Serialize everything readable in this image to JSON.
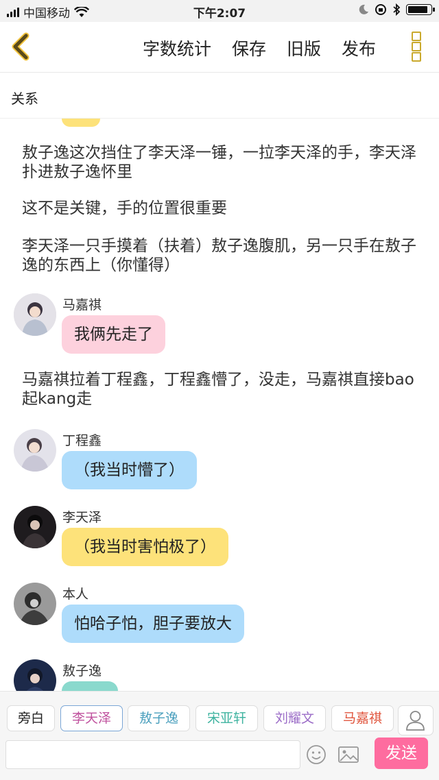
{
  "status_bar": {
    "carrier": "中国移动",
    "time": "下午2:07",
    "battery_fraction": 0.9
  },
  "nav": {
    "actions": [
      "字数统计",
      "保存",
      "旧版",
      "发布"
    ],
    "accent": "#c9a92c"
  },
  "relation_label": "关系",
  "narrations": [
    "敖子逸这次挡住了李天泽一锤，一拉李天泽的手，李天泽扑进敖子逸怀里",
    "这不是关键，手的位置很重要",
    "李天泽一只手摸着（扶着）敖子逸腹肌，另一只手在敖子逸的东西上（你懂得）",
    "马嘉祺拉着丁程鑫，丁程鑫懵了，没走，马嘉祺直接bao起kang走"
  ],
  "messages": [
    {
      "name": "马嘉祺",
      "text": "我俩先走了",
      "bubble_color": "#fdd1dd"
    },
    {
      "name": "丁程鑫",
      "text": "（我当时懵了）",
      "bubble_color": "#aedcfb"
    },
    {
      "name": "李天泽",
      "text": "（我当时害怕极了）",
      "bubble_color": "#fde27a"
    },
    {
      "name": "本人",
      "text": "怕哈子怕，胆子要放大",
      "bubble_color": "#aedcfb"
    },
    {
      "name": "敖子逸",
      "text": "",
      "bubble_color": "#8ad9cd"
    }
  ],
  "roles": [
    {
      "label": "旁白",
      "color": "#222222"
    },
    {
      "label": "李天泽",
      "color": "#c0529e"
    },
    {
      "label": "敖子逸",
      "color": "#4a9fbd"
    },
    {
      "label": "宋亚轩",
      "color": "#3fb3a0"
    },
    {
      "label": "刘耀文",
      "color": "#9b6cc7"
    },
    {
      "label": "马嘉祺",
      "color": "#e0553d"
    }
  ],
  "input": {
    "placeholder": "",
    "value": ""
  },
  "send_label": "发送",
  "icons": {
    "back": "chevron-left-icon",
    "more": "more-vertical-icon",
    "emoji": "smiley-icon",
    "image": "image-icon",
    "user": "user-icon"
  }
}
